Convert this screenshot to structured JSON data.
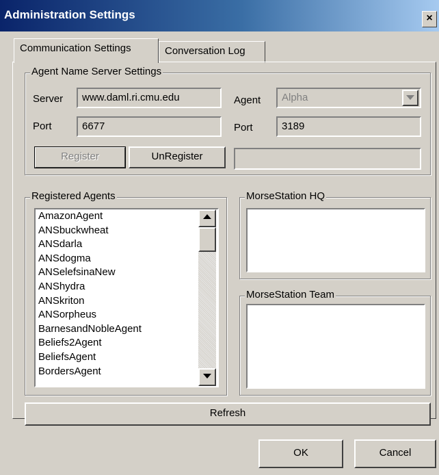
{
  "window": {
    "title": "Administration Settings",
    "close_label": "×"
  },
  "tabs": [
    {
      "label": "Communication Settings",
      "active": true
    },
    {
      "label": "Conversation Log",
      "active": false
    }
  ],
  "ans_settings": {
    "group_label": "Agent Name Server Settings",
    "server_label": "Server",
    "server_value": "www.daml.ri.cmu.edu",
    "port_label": "Port",
    "port_value": "6677",
    "agent_label": "Agent",
    "agent_value": "Alpha",
    "agent_port_label": "Port",
    "agent_port_value": "3189",
    "register_label": "Register",
    "unregister_label": "UnRegister",
    "status_value": ""
  },
  "registered_agents": {
    "group_label": "Registered Agents",
    "items": [
      "AmazonAgent",
      "ANSbuckwheat",
      "ANSdarla",
      "ANSdogma",
      "ANSelefsinaNew",
      "ANShydra",
      "ANSkriton",
      "ANSorpheus",
      "BarnesandNobleAgent",
      "Beliefs2Agent",
      "BeliefsAgent",
      "BordersAgent"
    ]
  },
  "morse_hq": {
    "group_label": "MorseStation HQ"
  },
  "morse_team": {
    "group_label": "MorseStation Team"
  },
  "refresh_label": "Refresh",
  "ok_label": "OK",
  "cancel_label": "Cancel"
}
